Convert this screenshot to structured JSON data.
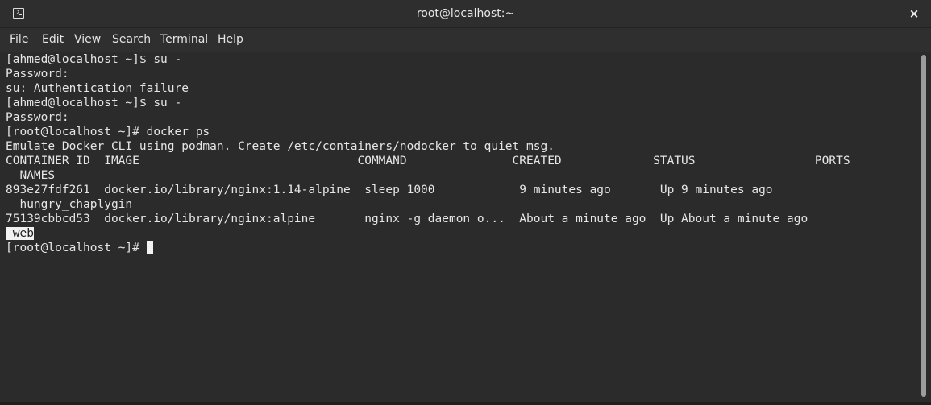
{
  "window": {
    "title": "root@localhost:~",
    "close_glyph": "×"
  },
  "menubar": {
    "items": [
      "File",
      "Edit",
      "View",
      "Search",
      "Terminal",
      "Help"
    ]
  },
  "terminal": {
    "lines": [
      "[ahmed@localhost ~]$ su -",
      "Password:",
      "su: Authentication failure",
      "[ahmed@localhost ~]$ su -",
      "Password:",
      "[root@localhost ~]# docker ps",
      "Emulate Docker CLI using podman. Create /etc/containers/nodocker to quiet msg.",
      "CONTAINER ID  IMAGE                               COMMAND               CREATED             STATUS                 PORTS",
      "  NAMES",
      "893e27fdf261  docker.io/library/nginx:1.14-alpine  sleep 1000            9 minutes ago       Up 9 minutes ago",
      "  hungry_chaplygin",
      "75139cbbcd53  docker.io/library/nginx:alpine       nginx -g daemon o...  About a minute ago  Up About a minute ago"
    ],
    "highlighted_name": " web",
    "prompt": "[root@localhost ~]# "
  },
  "icons": {
    "window_icon": "terminal-icon",
    "close_icon": "close-icon"
  },
  "colors": {
    "background": "#2b2b2b",
    "text": "#e6e6e6",
    "selection": "#f2f2f2"
  }
}
